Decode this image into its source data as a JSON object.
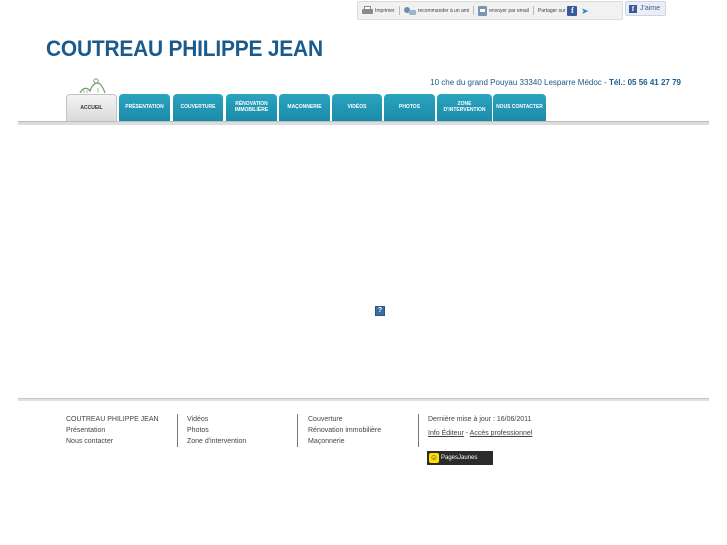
{
  "topbar": {
    "print_label": "Imprimer",
    "recommend_label": "recommander à un ami",
    "email_label": "envoyer par email",
    "share_label": "Partager sur",
    "like_label": "J'aime"
  },
  "header": {
    "company_name": "COUTREAU PHILIPPE JEAN",
    "address": "10 che du grand Pouyau 33340 Lesparre Médoc",
    "tel_label": "Tél.: 05 56 41 27 79"
  },
  "nav": {
    "tabs": [
      {
        "label": "ACCUEIL",
        "active": true
      },
      {
        "label": "PRÉSENTATION"
      },
      {
        "label": "COUVERTURE"
      },
      {
        "label": "RÉNOVATION IMMOBILIÈRE"
      },
      {
        "label": "MAÇONNERIE"
      },
      {
        "label": "VIDÉOS"
      },
      {
        "label": "PHOTOS"
      },
      {
        "label": "ZONE D'INTERVENTION"
      },
      {
        "label": "NOUS CONTACTER"
      }
    ]
  },
  "main": {
    "placeholder_glyph": "?"
  },
  "footer": {
    "col1": [
      "COUTREAU PHILIPPE JEAN",
      "Présentation",
      "Nous contacter"
    ],
    "col2": [
      "Vidéos",
      "Photos",
      "Zone d'intervention"
    ],
    "col3": [
      "Couverture",
      "Rénovation immobilière",
      "Maçonnerie"
    ],
    "last_update": "Dernière mise à jour : 16/06/2011",
    "info_editor": "Info Éditeur",
    "link_sep": " - ",
    "pro_access": "Accès professionnel",
    "pagesjaunes_label": "PagesJaunes"
  },
  "colors": {
    "brand_blue": "#1a5a8c",
    "tab_teal": "#1a8aa8"
  }
}
